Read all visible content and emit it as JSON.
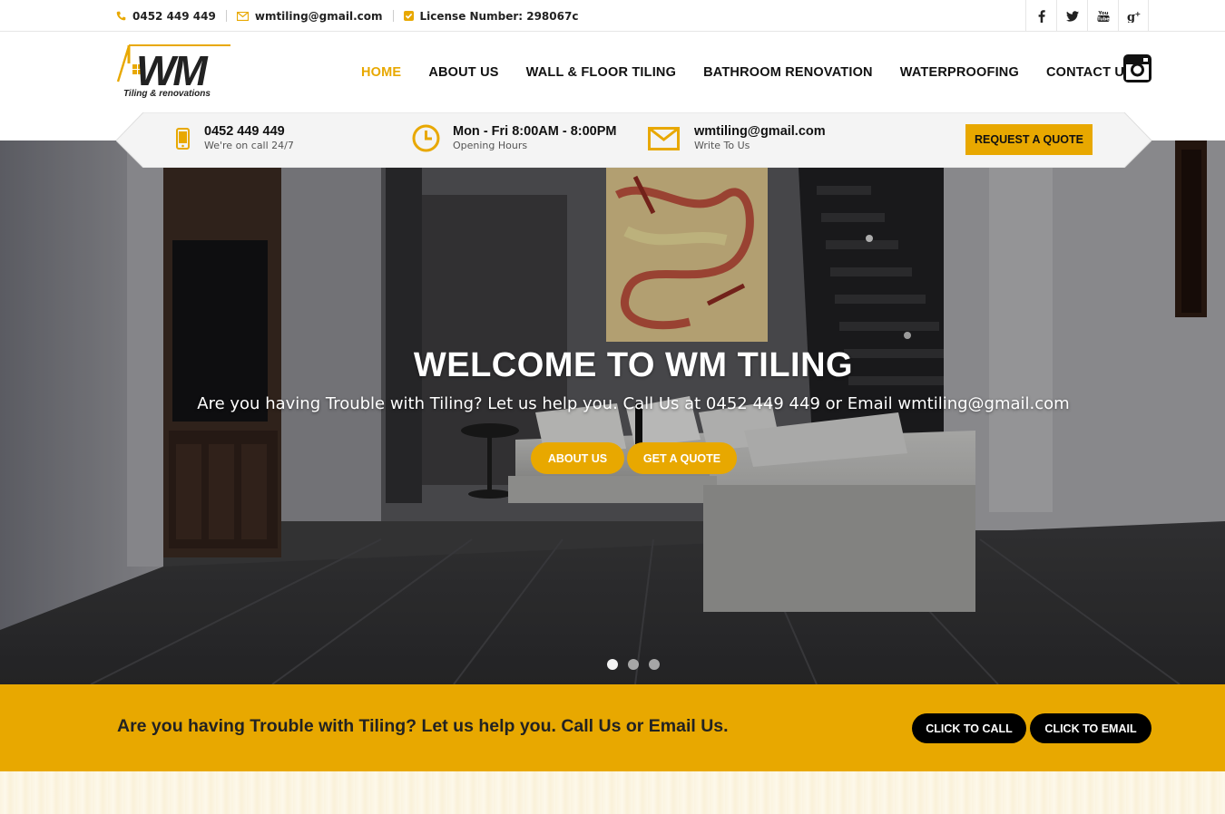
{
  "topbar": {
    "phone": "0452 449 449",
    "email": "wmtiling@gmail.com",
    "license": "License Number: 298067c",
    "social": [
      "f",
      "t",
      "You Tube",
      "g+"
    ]
  },
  "logo": {
    "title": "WM",
    "tagline": "Tiling & renovations"
  },
  "nav": {
    "items": [
      "HOME",
      "ABOUT US",
      "WALL & FLOOR TILING",
      "BATHROOM RENOVATION",
      "WATERPROOFING",
      "CONTACT US"
    ],
    "active": "HOME"
  },
  "strip": {
    "phone_title": "0452 449 449",
    "phone_sub": "We're on call 24/7",
    "hours_title": "Mon - Fri 8:00AM - 8:00PM",
    "hours_sub": "Opening Hours",
    "email_title": "wmtiling@gmail.com",
    "email_sub": "Write To Us",
    "quote_button": "REQUEST A QUOTE"
  },
  "hero": {
    "title": "WELCOME TO WM TILING",
    "subtitle": "Are you having Trouble with Tiling? Let us help you. Call Us at 0452 449 449 or Email wmtiling@gmail.com",
    "button_about": "ABOUT US",
    "button_quote": "GET A QUOTE",
    "slides": 3,
    "active_slide": 1
  },
  "cta": {
    "message": "Are you having Trouble with Tiling? Let us help you. Call Us or Email Us.",
    "call_button": "CLICK TO CALL",
    "email_button": "CLICK TO EMAIL"
  },
  "colors": {
    "accent": "#e8a800",
    "dark": "#111111",
    "white": "#ffffff"
  },
  "icons": {
    "phone": "phone-icon",
    "email": "envelope-icon",
    "license": "check-square-icon",
    "mobile": "mobile-icon",
    "clock": "clock-icon",
    "instagram": "instagram-icon"
  }
}
